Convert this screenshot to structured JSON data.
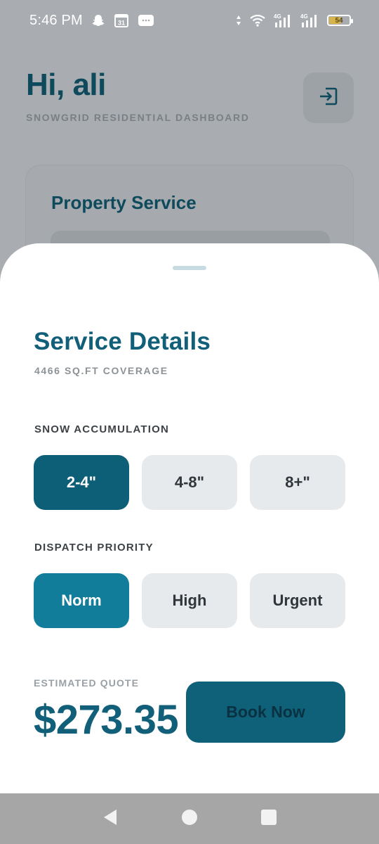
{
  "status_bar": {
    "time": "5:46 PM",
    "calendar_day": "31",
    "battery_level": "54",
    "network_label_1": "4G",
    "network_label_2": "4G"
  },
  "dashboard": {
    "greeting": "Hi, ali",
    "subtitle": "SNOWGRID RESIDENTIAL DASHBOARD",
    "property_card_title": "Property Service"
  },
  "sheet": {
    "title": "Service Details",
    "coverage": "4466 SQ.FT COVERAGE",
    "snow_label": "SNOW ACCUMULATION",
    "snow_options": [
      "2-4\"",
      "4-8\"",
      "8+\""
    ],
    "snow_selected": "2-4\"",
    "priority_label": "DISPATCH PRIORITY",
    "priority_options": [
      "Norm",
      "High",
      "Urgent"
    ],
    "priority_selected": "Norm",
    "quote_label": "ESTIMATED QUOTE",
    "quote_value": "$273.35",
    "book_button": "Book Now"
  },
  "colors": {
    "primary_dark": "#0d5e77",
    "primary_teal": "#127d9a",
    "title_teal": "#115f78",
    "option_bg": "#e7eaed"
  },
  "icons": {
    "logout": "logout-icon",
    "back": "back-triangle-icon",
    "home": "home-circle-icon",
    "recents": "recents-square-icon"
  }
}
